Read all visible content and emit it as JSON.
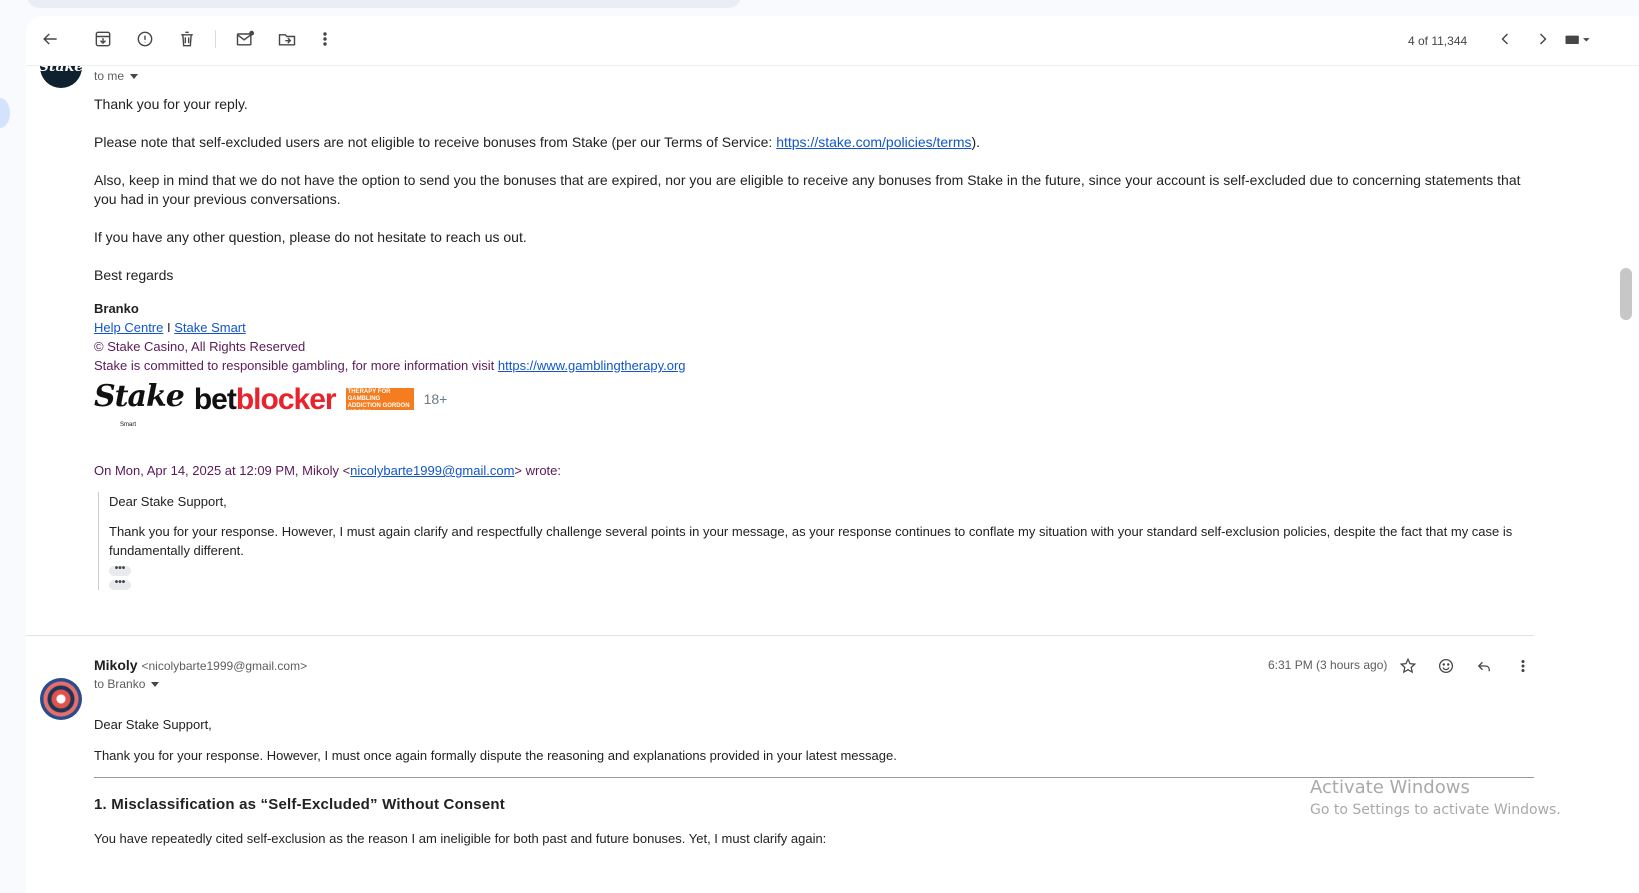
{
  "toolbar": {
    "counter": "4 of 11,344",
    "icons": [
      "back-arrow-icon",
      "archive-icon",
      "report-spam-icon",
      "delete-icon",
      "mark-unread-icon",
      "move-to-icon",
      "more-vert-icon",
      "newer-icon",
      "older-icon",
      "keyboard-icon"
    ]
  },
  "message1": {
    "avatar_text": "Stake",
    "to_label": "to me",
    "p1": "Thank you for your reply.",
    "p2_prefix": "Please note that self-excluded users are not eligible to receive bonuses from Stake (per our Terms of Service: ",
    "p2_link": "https://stake.com/policies/terms",
    "p2_suffix": ").",
    "p3": "Also, keep in mind that we do not have the option to send you the bonuses that are expired, nor you are eligible to receive any bonuses from Stake in the future, since your account is self-excluded due to concerning statements that you had in your previous conversations.",
    "p4": "If you have any other question, please do not hesitate to reach us out.",
    "p5": "Best regards",
    "signature": {
      "name": "Branko",
      "link1": "Help Centre",
      "separator": " I ",
      "link2": "Stake Smart",
      "copyright": "© Stake Casino, All Rights Reserved",
      "responsible_prefix": "Stake is committed to responsible gambling, for more information visit ",
      "responsible_link": "https://www.gamblingtherapy.org",
      "logo_stake": "Stake",
      "logo_stake_sub": "Smart",
      "logo_bet": "bet",
      "logo_blocker": "blocker",
      "logo_gt": "THERAPY FOR GAMBLING ADDICTION GORDON MOODY",
      "logo_18": "18+"
    },
    "quote_header_prefix": "On Mon, Apr 14, 2025 at 12:09 PM, Mikoly <",
    "quote_header_email": "nicolybarte1999@gmail.com",
    "quote_header_suffix": "> wrote:",
    "quote_p1": "Dear Stake Support,",
    "quote_p2": "Thank you for your response. However, I must again clarify and respectfully challenge several points in your message, as your response continues to conflate my situation with your standard self-exclusion policies, despite the fact that my case is fundamentally different.",
    "dots": "•••"
  },
  "message2": {
    "sender_name": "Mikoly",
    "sender_email": "<nicolybarte1999@gmail.com>",
    "to_label": "to Branko",
    "time": "6:31 PM (3 hours ago)",
    "actions": [
      "star-icon",
      "emoji-icon",
      "reply-icon",
      "more-vert-icon"
    ],
    "p1": "Dear Stake Support,",
    "p2": "Thank you for your response. However, I must once again formally dispute the reasoning and explanations provided in your latest message.",
    "heading": "1. Misclassification as “Self-Excluded” Without Consent",
    "p3": "You have repeatedly cited self-exclusion as the reason I am ineligible for both past and future bonuses. Yet, I must clarify again:"
  },
  "watermark": {
    "line1": "Activate Windows",
    "line2": "Go to Settings to activate Windows."
  }
}
